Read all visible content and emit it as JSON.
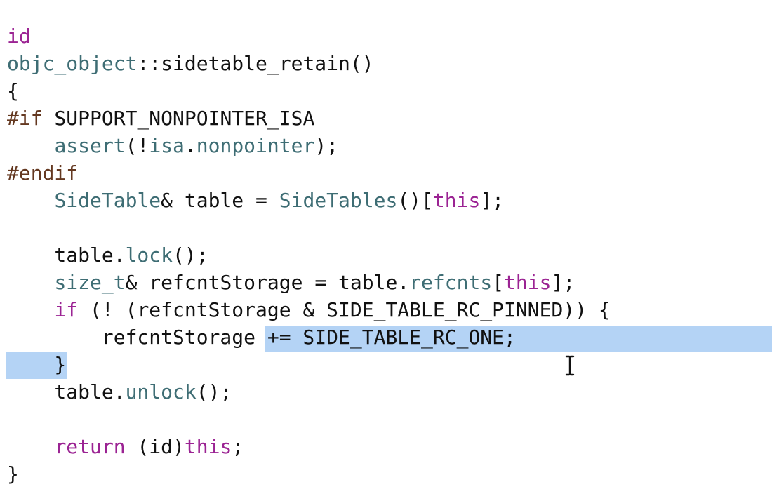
{
  "editor": {
    "lines": [
      {
        "tokens": [
          {
            "t": "id",
            "c": "kw"
          }
        ]
      },
      {
        "tokens": [
          {
            "t": "objc_object",
            "c": "ty"
          },
          {
            "t": "::sidetable_retain()",
            "c": ""
          }
        ]
      },
      {
        "tokens": [
          {
            "t": "{",
            "c": ""
          }
        ]
      },
      {
        "tokens": [
          {
            "t": "#if",
            "c": "pp"
          },
          {
            "t": " SUPPORT_NONPOINTER_ISA",
            "c": ""
          }
        ]
      },
      {
        "tokens": [
          {
            "t": "    ",
            "c": ""
          },
          {
            "t": "assert",
            "c": "fn"
          },
          {
            "t": "(!",
            "c": ""
          },
          {
            "t": "isa",
            "c": "ty"
          },
          {
            "t": ".",
            "c": ""
          },
          {
            "t": "nonpointer",
            "c": "fn"
          },
          {
            "t": ");",
            "c": ""
          }
        ]
      },
      {
        "tokens": [
          {
            "t": "#endif",
            "c": "pp"
          }
        ]
      },
      {
        "tokens": [
          {
            "t": "    ",
            "c": ""
          },
          {
            "t": "SideTable",
            "c": "ty"
          },
          {
            "t": "& table = ",
            "c": ""
          },
          {
            "t": "SideTables",
            "c": "fn"
          },
          {
            "t": "()[",
            "c": ""
          },
          {
            "t": "this",
            "c": "kw"
          },
          {
            "t": "];",
            "c": ""
          }
        ]
      },
      {
        "tokens": [
          {
            "t": "",
            "c": ""
          }
        ]
      },
      {
        "tokens": [
          {
            "t": "    table.",
            "c": ""
          },
          {
            "t": "lock",
            "c": "fn"
          },
          {
            "t": "();",
            "c": ""
          }
        ]
      },
      {
        "tokens": [
          {
            "t": "    ",
            "c": ""
          },
          {
            "t": "size_t",
            "c": "ty"
          },
          {
            "t": "& refcntStorage = table.",
            "c": ""
          },
          {
            "t": "refcnts",
            "c": "fn"
          },
          {
            "t": "[",
            "c": ""
          },
          {
            "t": "this",
            "c": "kw"
          },
          {
            "t": "];",
            "c": ""
          }
        ]
      },
      {
        "tokens": [
          {
            "t": "    ",
            "c": ""
          },
          {
            "t": "if",
            "c": "kw"
          },
          {
            "t": " (! (refcntStorage & SIDE_TABLE_RC_PINNED)) {",
            "c": ""
          }
        ]
      },
      {
        "tokens": [
          {
            "t": "        refcntStorage += SIDE_TABLE_RC_ONE;",
            "c": ""
          }
        ]
      },
      {
        "tokens": [
          {
            "t": "    }",
            "c": ""
          }
        ]
      },
      {
        "tokens": [
          {
            "t": "    table.",
            "c": ""
          },
          {
            "t": "unlock",
            "c": "fn"
          },
          {
            "t": "();",
            "c": ""
          }
        ]
      },
      {
        "tokens": [
          {
            "t": "",
            "c": ""
          }
        ]
      },
      {
        "tokens": [
          {
            "t": "    ",
            "c": ""
          },
          {
            "t": "return",
            "c": "kw"
          },
          {
            "t": " (id)",
            "c": ""
          },
          {
            "t": "this",
            "c": "kw"
          },
          {
            "t": ";",
            "c": ""
          }
        ]
      },
      {
        "tokens": [
          {
            "t": "}",
            "c": ""
          }
        ]
      }
    ]
  },
  "colors": {
    "keyword": "#9b2393",
    "preprocessor": "#643820",
    "type": "#3e6d74",
    "selection": "#b4d3f5"
  },
  "cursor": {
    "icon": "text-cursor-icon"
  }
}
